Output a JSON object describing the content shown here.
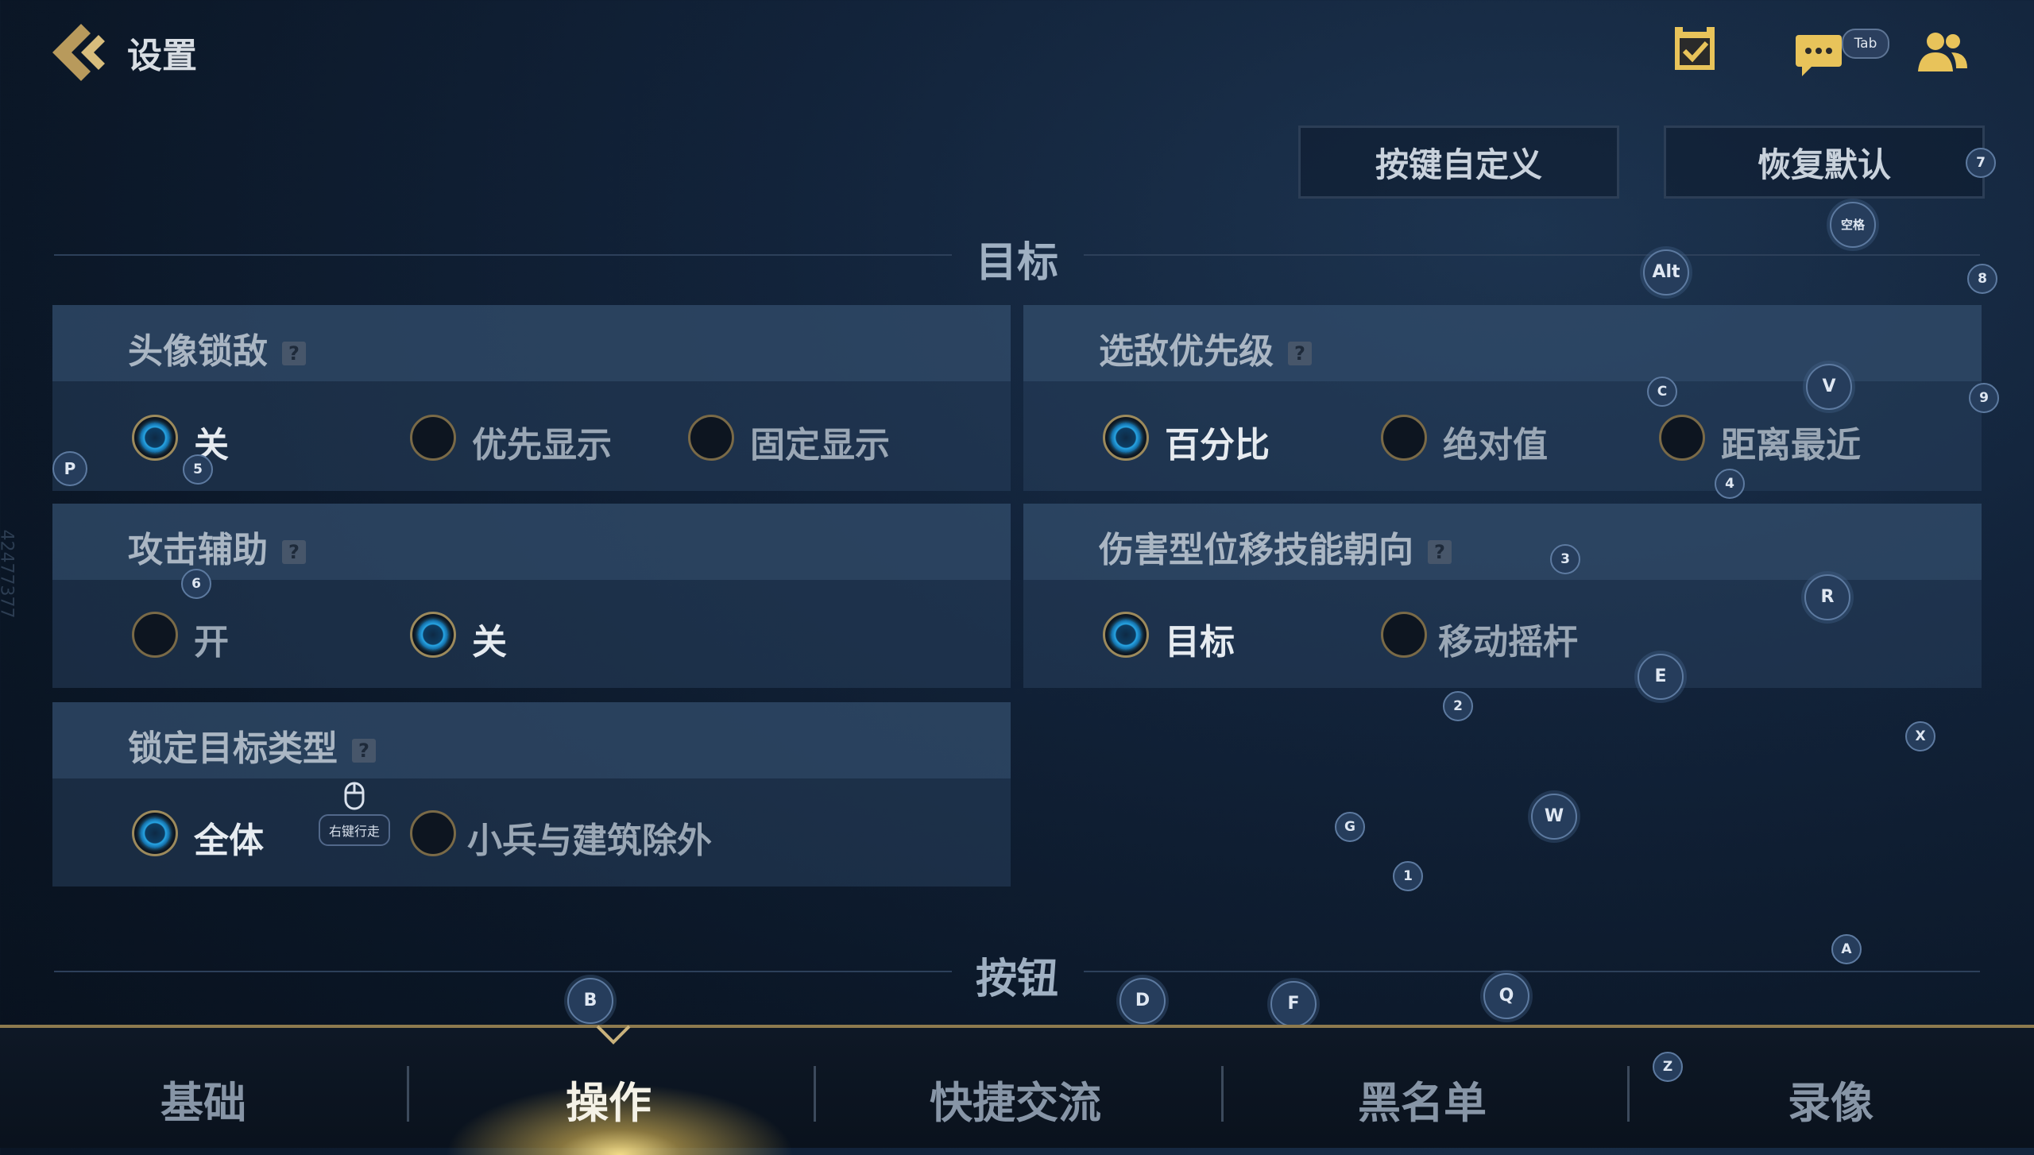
{
  "header": {
    "title": "设置",
    "icons": [
      "back-arrow-icon",
      "task-check-icon",
      "chat-icon",
      "friends-icon"
    ],
    "chat_key": "Tab"
  },
  "actions": {
    "custom_keys": "按键自定义",
    "restore_default": "恢复默认"
  },
  "sections": {
    "target": "目标",
    "buttons": "按钮"
  },
  "panels": {
    "avatar_lock": {
      "label": "头像锁敌",
      "options": [
        "关",
        "优先显示",
        "固定显示"
      ],
      "selected": "关"
    },
    "enemy_priority": {
      "label": "选敌优先级",
      "options": [
        "百分比",
        "绝对值",
        "距离最近"
      ],
      "selected": "百分比"
    },
    "attack_assist": {
      "label": "攻击辅助",
      "options": [
        "开",
        "关"
      ],
      "selected": "关"
    },
    "dash_direction": {
      "label": "伤害型位移技能朝向",
      "options": [
        "目标",
        "移动摇杆"
      ],
      "selected": "目标"
    },
    "lock_target_type": {
      "label": "锁定目标类型",
      "options": [
        "全体",
        "小兵与建筑除外"
      ],
      "selected": "全体"
    }
  },
  "help_glyph": "?",
  "mouse_tip": "右键行走",
  "key_hints": [
    "空格",
    "Alt",
    "7",
    "8",
    "9",
    "P",
    "5",
    "6",
    "C",
    "V",
    "4",
    "3",
    "R",
    "E",
    "2",
    "X",
    "W",
    "G",
    "1",
    "A",
    "B",
    "D",
    "F",
    "Q",
    "Z"
  ],
  "nav": {
    "tabs": [
      "基础",
      "操作",
      "快捷交流",
      "黑名单",
      "录像"
    ],
    "active": "操作"
  },
  "side_code": "42477377",
  "colors": {
    "accent_gold": "#8d7a4e",
    "radio_on": "#27a6e6",
    "background": "#0b1727"
  }
}
